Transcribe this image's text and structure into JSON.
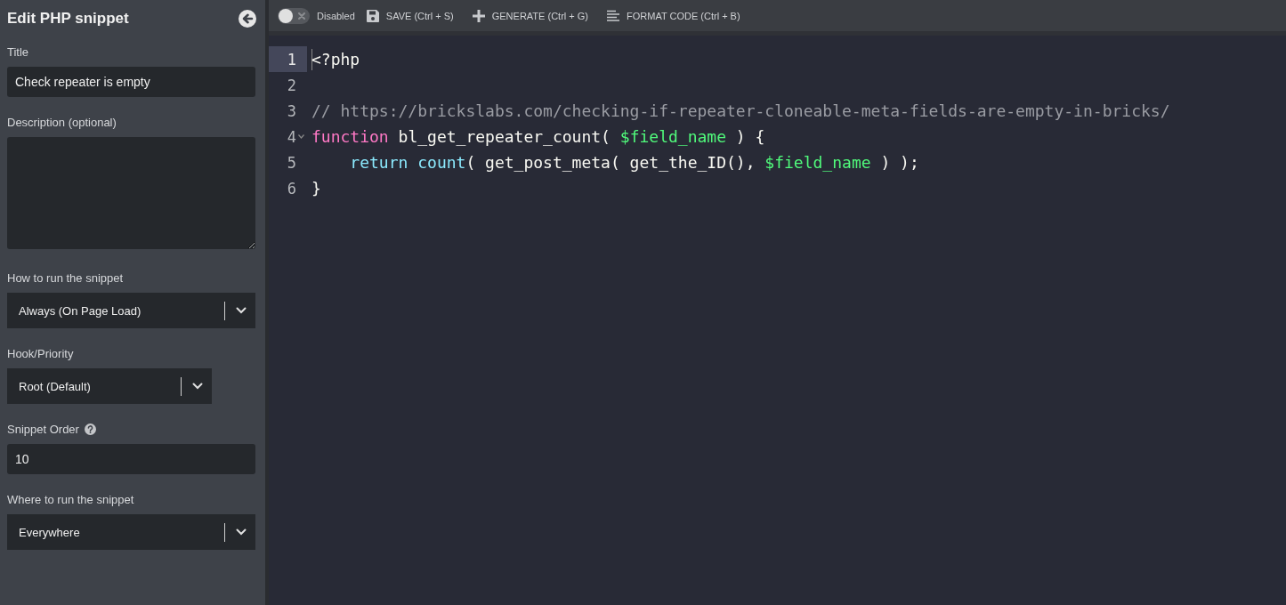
{
  "sidebar": {
    "title": "Edit PHP snippet",
    "fields": [
      {
        "kind": "text",
        "label": "Title",
        "value": "Check repeater is empty",
        "narrow": false,
        "help": false
      },
      {
        "kind": "textarea",
        "label": "Description (optional)",
        "narrow": false,
        "help": false
      },
      {
        "kind": "select",
        "label": "How to run the snippet",
        "value": "Always (On Page Load)",
        "narrow": false,
        "help": false
      },
      {
        "kind": "select",
        "label": "Hook/Priority",
        "value": "Root (Default)",
        "narrow": true,
        "help": false
      },
      {
        "kind": "text",
        "label": "Snippet Order",
        "value": "10",
        "narrow": false,
        "help": true
      },
      {
        "kind": "select",
        "label": "Where to run the snippet",
        "value": "Everywhere",
        "narrow": false,
        "help": false
      }
    ]
  },
  "toolbar": {
    "toggle": {
      "on": false,
      "label": "Disabled"
    },
    "buttons": [
      {
        "kind": "save",
        "label": "SAVE (Ctrl + S)"
      },
      {
        "kind": "generate",
        "label": "GENERATE (Ctrl + G)"
      },
      {
        "kind": "format",
        "label": "FORMAT CODE (Ctrl + B)"
      }
    ]
  },
  "editor": {
    "lines": [
      {
        "number": "1",
        "active": true,
        "foldable": false,
        "tokens": [
          {
            "kind": "plain",
            "text": "<?php"
          }
        ]
      },
      {
        "number": "2",
        "active": false,
        "foldable": false
      },
      {
        "number": "3",
        "active": false,
        "foldable": false,
        "tokens": [
          {
            "kind": "comment",
            "text": "// https://brickslabs.com/checking-if-repeater-cloneable-meta-fields-are-empty-in-bricks/"
          }
        ]
      },
      {
        "number": "4",
        "active": false,
        "foldable": true,
        "tokens": [
          {
            "kind": "keyword",
            "text": "function"
          },
          {
            "kind": "plain",
            "text": " bl_get_repeater_count( "
          },
          {
            "kind": "variable",
            "text": "$field_name"
          },
          {
            "kind": "plain",
            "text": " ) {"
          }
        ]
      },
      {
        "number": "5",
        "active": false,
        "foldable": false,
        "tokens": [
          {
            "kind": "builtin",
            "text": "    return count"
          },
          {
            "kind": "plain",
            "text": "( get_post_meta( get_the_ID(), "
          },
          {
            "kind": "variable",
            "text": "$field_name"
          },
          {
            "kind": "plain",
            "text": " ) );"
          }
        ]
      },
      {
        "number": "6",
        "active": false,
        "foldable": false,
        "tokens": [
          {
            "kind": "plain",
            "text": "}"
          }
        ]
      }
    ]
  }
}
